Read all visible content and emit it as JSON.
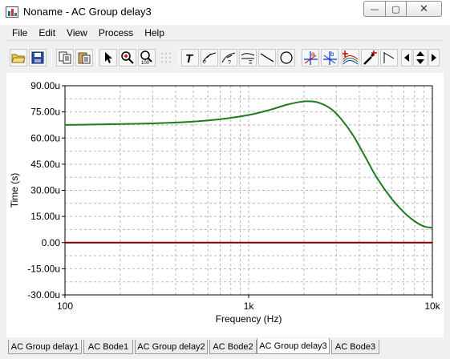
{
  "window": {
    "title": "Noname - AC Group delay3",
    "minimize_glyph": "—",
    "maximize_glyph": "▢",
    "close_glyph": "✕"
  },
  "menu": [
    "File",
    "Edit",
    "View",
    "Process",
    "Help"
  ],
  "toolbar": {
    "icons": [
      "open-folder-icon",
      "save-icon",
      "copy-icon",
      "paste-icon",
      "pointer-icon",
      "zoom-in-icon",
      "zoom-100-icon",
      "grid-icon",
      "text-icon",
      "curve-label-icon",
      "curve-label-2-icon",
      "curve-label-3-icon",
      "line-icon",
      "ellipse-icon",
      "cursor-a-icon",
      "cursor-b-icon",
      "add-trace-icon",
      "pick-color-icon",
      "angle-icon",
      "arrow-left-icon",
      "arrow-updown-icon",
      "arrow-right-icon"
    ],
    "colors": {
      "cursor": "#cc0000",
      "accent": "#0033cc"
    }
  },
  "tabs": [
    "AC Group delay1",
    "AC Bode1",
    "AC Group delay2",
    "AC Bode2",
    "AC Group delay3",
    "AC Bode3"
  ],
  "active_tab": "AC Group delay3",
  "chart_data": {
    "type": "line",
    "title": "",
    "xlabel": "Frequency (Hz)",
    "ylabel": "Time (s)",
    "xscale": "log",
    "xlim": [
      100,
      10000
    ],
    "ylim": [
      -30,
      90
    ],
    "x_ticks": [
      100,
      1000,
      10000
    ],
    "x_tick_labels": [
      "100",
      "1k",
      "10k"
    ],
    "y_ticks": [
      90,
      75,
      60,
      45,
      30,
      15,
      0,
      -15,
      -30
    ],
    "y_tick_labels": [
      "90.00u",
      "75.00u",
      "60.00u",
      "45.00u",
      "30.00u",
      "15.00u",
      "0.00",
      "-15.00u",
      "-30.00u"
    ],
    "grid": true,
    "series": [
      {
        "color": "#1e7b1e",
        "x": [
          100,
          150,
          200,
          300,
          400,
          500,
          700,
          1000,
          1300,
          1600,
          1900,
          2100,
          2400,
          2800,
          3200,
          3700,
          4300,
          5000,
          6000,
          7000,
          8000,
          9000,
          10000
        ],
        "y": [
          67.5,
          67.8,
          68.0,
          68.4,
          68.9,
          69.4,
          70.8,
          73.2,
          76.1,
          79.0,
          80.7,
          81.1,
          80.3,
          76.8,
          70.7,
          61.6,
          49.4,
          37.0,
          25.2,
          17.4,
          12.3,
          9.3,
          8.6
        ]
      },
      {
        "color": "#7a0000",
        "x": [
          100,
          10000
        ],
        "y": [
          0,
          0
        ]
      }
    ]
  }
}
